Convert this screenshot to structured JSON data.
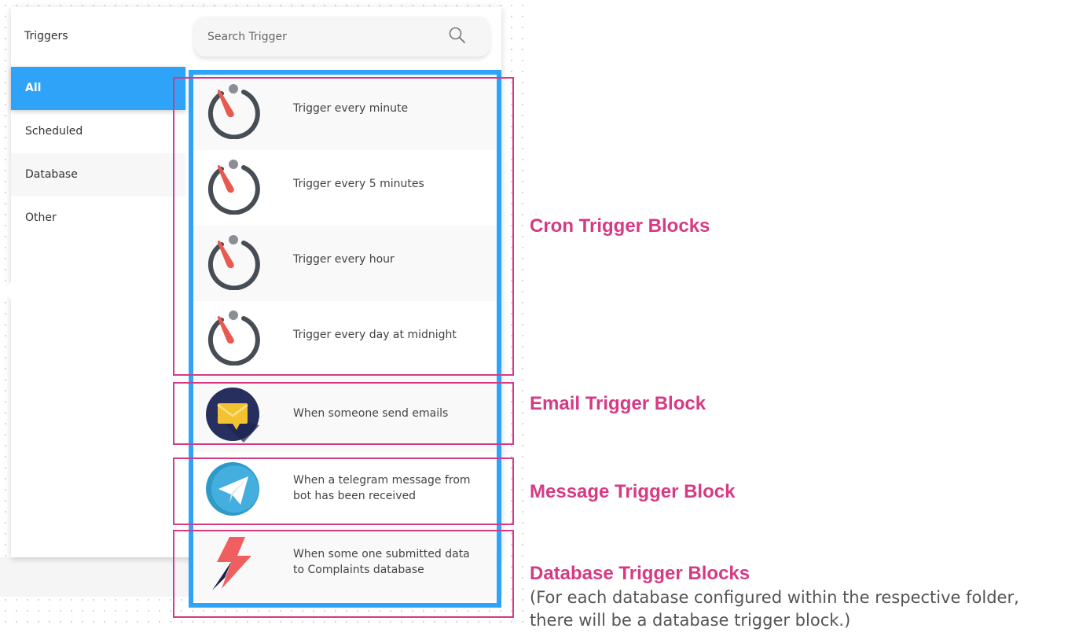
{
  "sidebar": {
    "title": "Triggers",
    "items": [
      {
        "label": "All"
      },
      {
        "label": "Scheduled"
      },
      {
        "label": "Database"
      },
      {
        "label": "Other"
      }
    ]
  },
  "search": {
    "placeholder": "Search Trigger",
    "value": ""
  },
  "triggers": [
    {
      "label": "Trigger every minute",
      "icon": "timer-icon"
    },
    {
      "label": "Trigger every 5 minutes",
      "icon": "timer-icon"
    },
    {
      "label": "Trigger every hour",
      "icon": "timer-icon"
    },
    {
      "label": "Trigger every day at midnight",
      "icon": "timer-icon"
    },
    {
      "label": "When someone send emails",
      "icon": "email-icon"
    },
    {
      "label": "When a telegram message from\nbot has been received",
      "icon": "telegram-icon"
    },
    {
      "label": "When some one submitted data\nto Complaints database",
      "icon": "lightning-icon"
    }
  ],
  "annotations": {
    "cron": "Cron Trigger Blocks",
    "email": "Email Trigger Block",
    "message": "Message Trigger Block",
    "database": "Database Trigger Blocks",
    "database_note": "(For each database configured within the respective folder,\n there will be a database trigger block.)"
  },
  "colors": {
    "accent": "#2ea3f8",
    "annotation": "#d63a85"
  }
}
